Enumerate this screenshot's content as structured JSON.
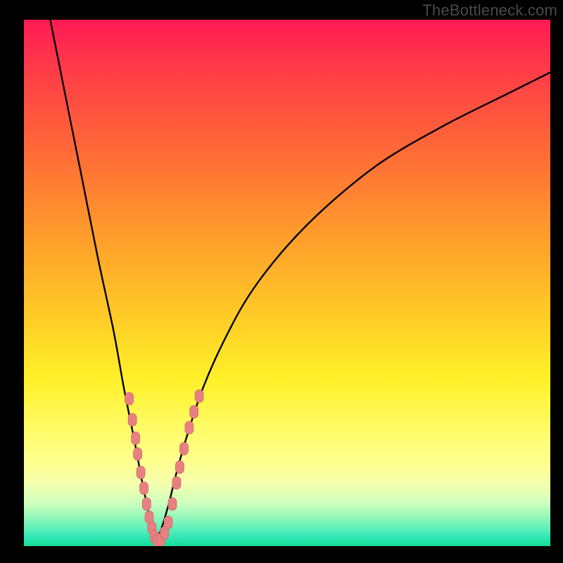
{
  "watermark": "TheBottleneck.com",
  "colors": {
    "frame": "#000000",
    "curve": "#000000",
    "marker_fill": "#e88081",
    "marker_stroke": "#d06a6c"
  },
  "chart_data": {
    "type": "line",
    "title": "",
    "xlabel": "",
    "ylabel": "",
    "xlim": [
      0,
      100
    ],
    "ylim": [
      0,
      100
    ],
    "series": [
      {
        "name": "bottleneck-curve",
        "description": "V-shaped bottleneck curve; y approximates percent bottleneck, minimum near x≈25",
        "x": [
          5,
          8,
          11,
          14,
          17,
          19,
          21,
          22.5,
          24,
          25,
          26,
          27.5,
          29,
          31,
          34,
          38,
          43,
          50,
          58,
          68,
          80,
          92,
          100
        ],
        "y": [
          100,
          85,
          70,
          55,
          41,
          30,
          20,
          12,
          5,
          1,
          3,
          8,
          14,
          21,
          30,
          39,
          48,
          57,
          65,
          73,
          80,
          86,
          90
        ]
      }
    ],
    "markers": {
      "name": "sample-points",
      "shape": "rounded-pill",
      "color": "#e88081",
      "points": [
        {
          "x": 20.0,
          "y": 28.0
        },
        {
          "x": 20.6,
          "y": 24.0
        },
        {
          "x": 21.2,
          "y": 20.5
        },
        {
          "x": 21.6,
          "y": 17.5
        },
        {
          "x": 22.2,
          "y": 14.0
        },
        {
          "x": 22.8,
          "y": 11.0
        },
        {
          "x": 23.3,
          "y": 8.0
        },
        {
          "x": 23.8,
          "y": 5.5
        },
        {
          "x": 24.3,
          "y": 3.5
        },
        {
          "x": 24.8,
          "y": 1.8
        },
        {
          "x": 25.3,
          "y": 1.0
        },
        {
          "x": 26.0,
          "y": 1.2
        },
        {
          "x": 26.7,
          "y": 2.5
        },
        {
          "x": 27.4,
          "y": 4.5
        },
        {
          "x": 28.2,
          "y": 8.0
        },
        {
          "x": 29.0,
          "y": 12.0
        },
        {
          "x": 29.6,
          "y": 15.0
        },
        {
          "x": 30.4,
          "y": 18.5
        },
        {
          "x": 31.4,
          "y": 22.5
        },
        {
          "x": 32.3,
          "y": 25.5
        },
        {
          "x": 33.3,
          "y": 28.5
        }
      ]
    }
  }
}
